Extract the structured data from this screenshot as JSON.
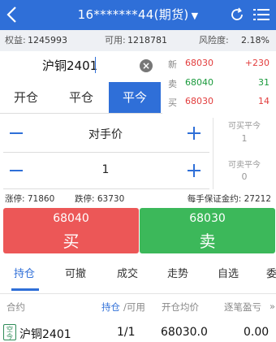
{
  "header": {
    "title": "16*******44(期货)",
    "caret": "▼",
    "back_icon": "chevron-left-icon",
    "refresh_icon": "refresh-icon",
    "menu_icon": "list-menu-icon"
  },
  "account": {
    "equity_label": "权益:",
    "equity_value": "1245993",
    "available_label": "可用:",
    "available_value": "1218781",
    "risk_label": "风险度:",
    "risk_value": "2.18%"
  },
  "instrument": {
    "name": "沪铜2401",
    "clear_label": "×"
  },
  "quotes": {
    "latest_label": "新",
    "latest_price": "68030",
    "latest_change": "+230",
    "ask_label": "卖",
    "ask_price": "68040",
    "ask_volume": "31",
    "bid_label": "买",
    "bid_price": "68030",
    "bid_volume": "14"
  },
  "order_tabs": {
    "open": "开仓",
    "close": "平仓",
    "close_today": "平今"
  },
  "price_input": {
    "value": "对手价"
  },
  "quantity_input": {
    "value": "1"
  },
  "side_info": {
    "closable_buy_label": "可买平今",
    "closable_buy_value": "1",
    "closable_sell_label": "可卖平今",
    "closable_sell_value": "0"
  },
  "limits": {
    "limit_up": "涨停: 71860",
    "limit_down": "跌停: 63730",
    "margin": "每手保证金约: 27212"
  },
  "buy_button": {
    "price": "68040",
    "label": "买"
  },
  "sell_button": {
    "price": "68030",
    "label": "卖"
  },
  "bottom_tabs": [
    "持仓",
    "可撤",
    "成交",
    "走势",
    "自选",
    "委"
  ],
  "positions": {
    "headers": {
      "contract": "合约",
      "hold": "持仓",
      "available": "/可用",
      "avg_price": "开仓均价",
      "pnl": "逐笔盈亏",
      "more": "»"
    },
    "rows": [
      {
        "badge": "空今",
        "contract": "沪铜2401",
        "hold_available": "1/1",
        "avg_price": "68030.0",
        "pnl": "0.00"
      }
    ]
  },
  "colors": {
    "primary_blue": "#2f6fd8",
    "buy_red": "#ec5757",
    "sell_green": "#3cb85a",
    "up_red": "#e23c3c",
    "down_green": "#1a9a3c"
  }
}
